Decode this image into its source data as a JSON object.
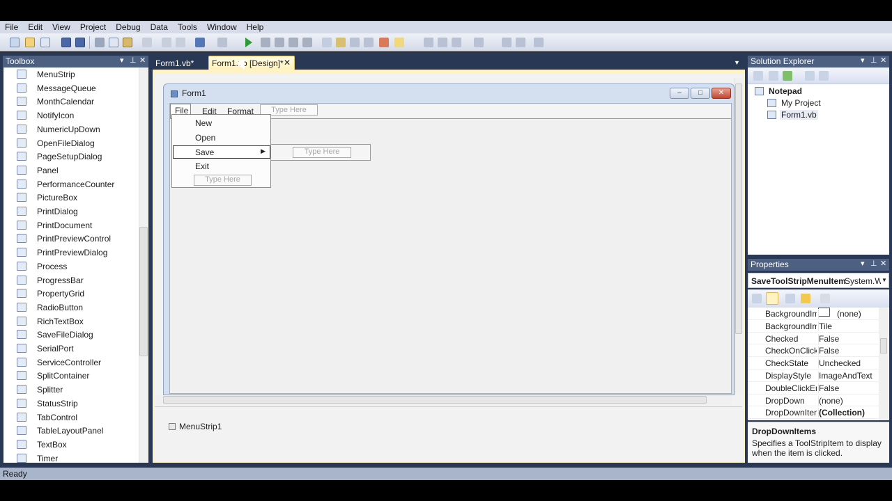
{
  "menu": [
    "File",
    "Edit",
    "View",
    "Project",
    "Debug",
    "Data",
    "Tools",
    "Window",
    "Help"
  ],
  "toolbox": {
    "title": "Toolbox",
    "items": [
      "MenuStrip",
      "MessageQueue",
      "MonthCalendar",
      "NotifyIcon",
      "NumericUpDown",
      "OpenFileDialog",
      "PageSetupDialog",
      "Panel",
      "PerformanceCounter",
      "PictureBox",
      "PrintDialog",
      "PrintDocument",
      "PrintPreviewControl",
      "PrintPreviewDialog",
      "Process",
      "ProgressBar",
      "PropertyGrid",
      "RadioButton",
      "RichTextBox",
      "SaveFileDialog",
      "SerialPort",
      "ServiceController",
      "SplitContainer",
      "Splitter",
      "StatusStrip",
      "TabControl",
      "TableLayoutPanel",
      "TextBox",
      "Timer"
    ]
  },
  "tabs": [
    {
      "label": "Form1.vb*"
    },
    {
      "label": "Form1.vb [Design]*"
    }
  ],
  "designer": {
    "form_title": "Form1",
    "menustrip": {
      "items": [
        "File",
        "Edit",
        "Format"
      ],
      "type_here": "Type Here"
    },
    "dropdown": {
      "items": [
        "New",
        "Open",
        "Save",
        "Exit"
      ],
      "type_here": "Type Here"
    },
    "submenu": {
      "type_here": "Type Here"
    },
    "component_tray": "MenuStrip1"
  },
  "solution_explorer": {
    "title": "Solution Explorer",
    "project": "Notepad",
    "children": [
      "My Project",
      "Form1.vb"
    ]
  },
  "properties": {
    "title": "Properties",
    "object_name": "SaveToolStripMenuItem",
    "object_type": "System.W",
    "rows": [
      {
        "name": "BackgroundIm",
        "value": "(none)"
      },
      {
        "name": "BackgroundIm",
        "value": "Tile"
      },
      {
        "name": "Checked",
        "value": "False"
      },
      {
        "name": "CheckOnClick",
        "value": "False"
      },
      {
        "name": "CheckState",
        "value": "Unchecked"
      },
      {
        "name": "DisplayStyle",
        "value": "ImageAndText"
      },
      {
        "name": "DoubleClickEn",
        "value": "False"
      },
      {
        "name": "DropDown",
        "value": "(none)"
      },
      {
        "name": "DropDownIten",
        "value": "(Collection)"
      }
    ],
    "desc_title": "DropDownItems",
    "desc_text": "Specifies a ToolStripItem to display when the item is clicked."
  },
  "status": "Ready"
}
